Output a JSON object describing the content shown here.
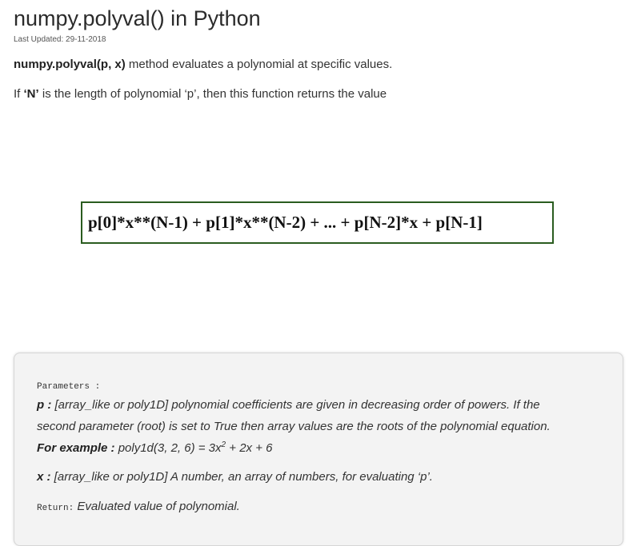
{
  "article": {
    "title": "numpy.polyval() in Python",
    "last_updated": "Last Updated: 29-11-2018",
    "intro": {
      "func_name": "numpy.polyval(p, x)",
      "rest": " method evaluates a polynomial at specific values."
    },
    "if_line": {
      "prefix": "If ",
      "n_bold": "‘N’",
      "rest": " is the length of polynomial ‘p’, then this function returns the value"
    },
    "formula": "p[0]*x**(N-1) + p[1]*x**(N-2) + ... + p[N-2]*x + p[N-1]"
  },
  "params_box": {
    "parameters_label": "Parameters :",
    "p_label": "p :",
    "p_line1": " [array_like or poly1D] polynomial coefficients are given in decreasing order of powers. If the",
    "p_line2": "second parameter (root) is set to True then array values are the roots of the polynomial equation.",
    "example_label": "For example :",
    "example_pre": " poly1d(3, 2, 6) = 3x",
    "example_sup": "2",
    "example_post": " + 2x + 6",
    "x_label": "x :",
    "x_text": " [array_like or poly1D] A number, an array of numbers, for evaluating ‘p’.",
    "return_label": "Return:",
    "return_text": " Evaluated value of polynomial."
  }
}
